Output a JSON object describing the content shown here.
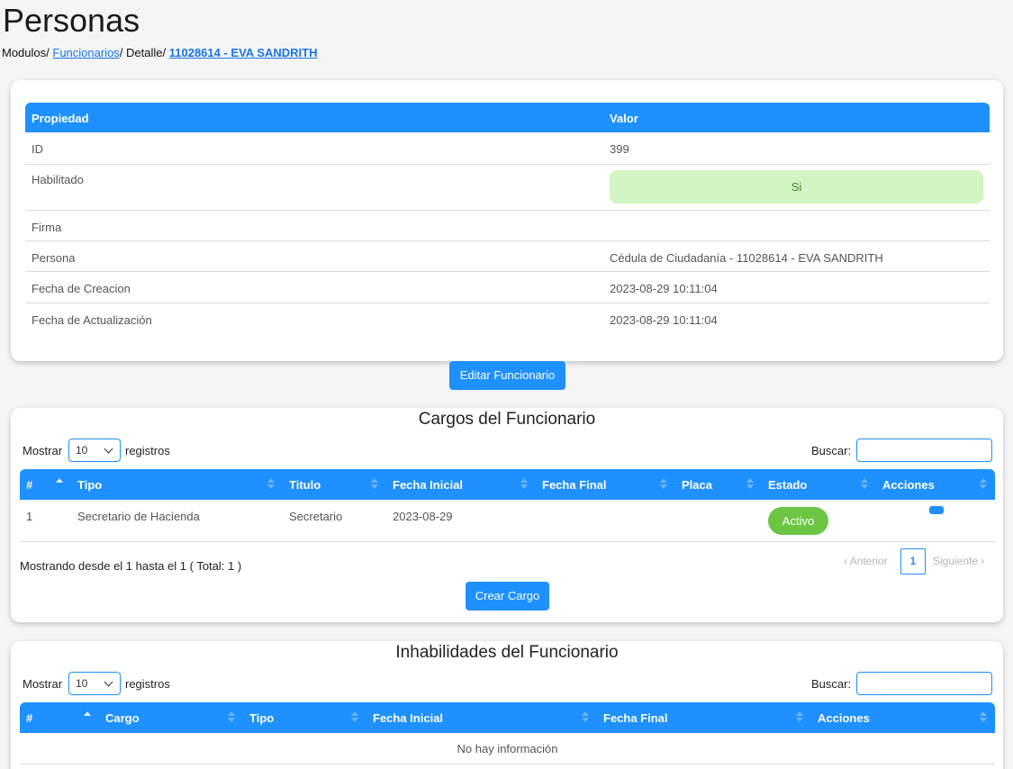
{
  "header": {
    "title": "Personas",
    "breadcrumb": {
      "modulos": "Modulos/",
      "funcionarios": "Funcionarios",
      "sep1": "/ Detalle/",
      "current": "11028614 - EVA SANDRITH"
    }
  },
  "properties": {
    "col_property": "Propiedad",
    "col_value": "Valor",
    "rows": [
      {
        "label": "ID",
        "value": "399"
      },
      {
        "label": "Habilitado",
        "value": "Si"
      },
      {
        "label": "Firma",
        "value": ""
      },
      {
        "label": "Persona",
        "value": "Cédula de Ciudadanía - 11028614 - EVA SANDRITH"
      },
      {
        "label": "Fecha de Creacion",
        "value": "2023-08-29 10:11:04"
      },
      {
        "label": "Fecha de Actualización",
        "value": "2023-08-29 10:11:04"
      }
    ]
  },
  "edit_button": "Editar Funcionario",
  "cargos": {
    "title": "Cargos del Funcionario",
    "show_label": "Mostrar",
    "show_value": "10",
    "records_label": "registros",
    "search_label": "Buscar:",
    "columns": [
      "#",
      "Tipo",
      "Titulo",
      "Fecha Inicial",
      "Fecha Final",
      "Placa",
      "Estado",
      "Acciones"
    ],
    "rows": [
      {
        "num": "1",
        "tipo": "Secretario de Hacienda",
        "titulo": "Secretario",
        "fecha_inicial": "2023-08-29",
        "fecha_final": "",
        "placa": "",
        "estado": "Activo"
      }
    ],
    "info": "Mostrando desde el 1 hasta el 1 ( Total: 1 )",
    "prev": "Anterior",
    "next": "Siguiente",
    "page": "1",
    "create_button": "Crear Cargo"
  },
  "inhabilidades": {
    "title": "Inhabilidades del Funcionario",
    "show_label": "Mostrar",
    "show_value": "10",
    "records_label": "registros",
    "search_label": "Buscar:",
    "columns": [
      "#",
      "Cargo",
      "Tipo",
      "Fecha Inicial",
      "Fecha Final",
      "Acciones"
    ],
    "empty": "No hay información"
  },
  "colors": {
    "primary": "#1e90ff",
    "success_badge": "#6cc644",
    "si_badge_bg": "#d3f5c4"
  }
}
